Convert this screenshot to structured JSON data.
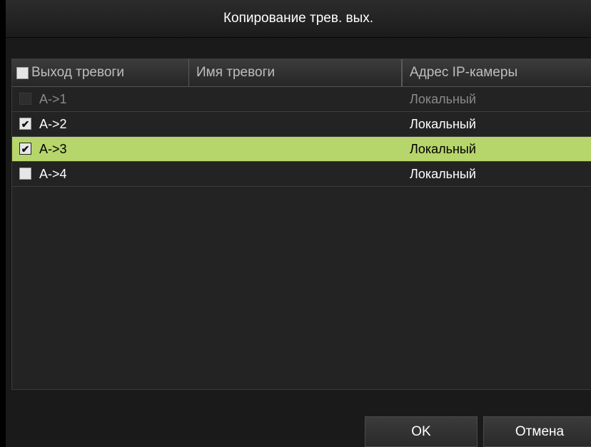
{
  "dialog": {
    "title": "Копирование трев. вых."
  },
  "table": {
    "columns": [
      "Выход тревоги",
      "Имя тревоги",
      "Адрес IP-камеры"
    ],
    "header_checked": false,
    "rows": [
      {
        "output": "A->1",
        "name": "",
        "address": "Локальный",
        "checked": false,
        "disabled": true,
        "selected": false
      },
      {
        "output": "A->2",
        "name": "",
        "address": "Локальный",
        "checked": true,
        "disabled": false,
        "selected": false
      },
      {
        "output": "A->3",
        "name": "",
        "address": "Локальный",
        "checked": true,
        "disabled": false,
        "selected": true
      },
      {
        "output": "A->4",
        "name": "",
        "address": "Локальный",
        "checked": false,
        "disabled": false,
        "selected": false
      }
    ]
  },
  "buttons": {
    "ok_label": "OK",
    "cancel_label": "Отмена"
  },
  "colors": {
    "selected_row": "#b6d56a",
    "background": "#1a1a1a"
  },
  "icons": {
    "check": "check-mark"
  }
}
